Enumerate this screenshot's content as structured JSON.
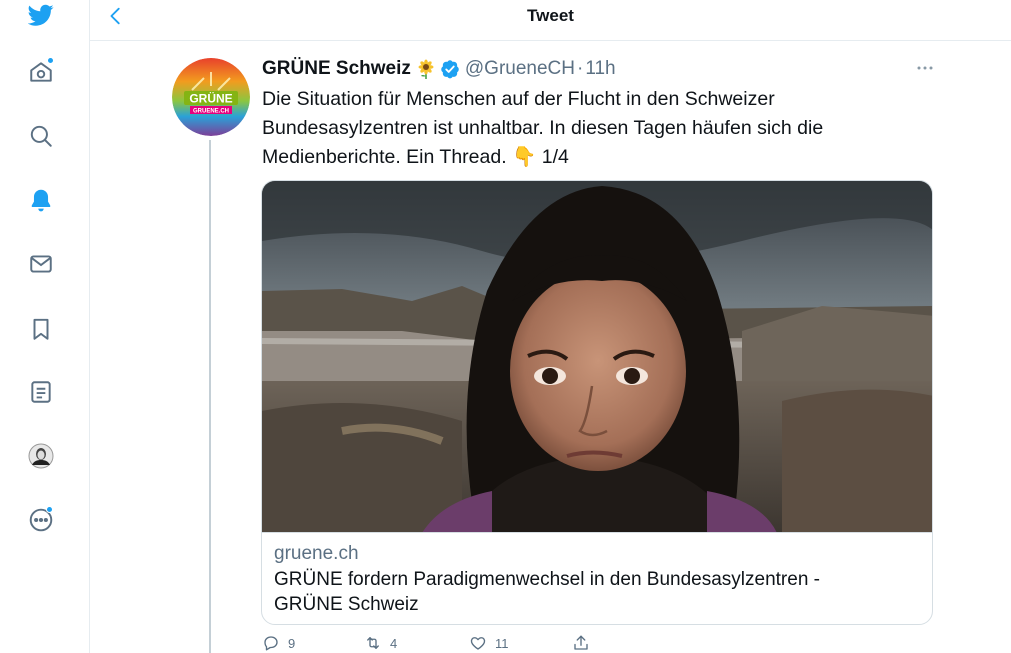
{
  "header": {
    "title": "Tweet"
  },
  "sidebar": {
    "items": [
      {
        "name": "twitter-logo-icon"
      },
      {
        "name": "home-icon"
      },
      {
        "name": "explore-icon"
      },
      {
        "name": "notifications-icon"
      },
      {
        "name": "messages-icon"
      },
      {
        "name": "bookmarks-icon"
      },
      {
        "name": "lists-icon"
      },
      {
        "name": "profile-avatar"
      },
      {
        "name": "more-icon"
      }
    ],
    "accent": "#1da1f2"
  },
  "tweet": {
    "display_name": "GRÜNE Schweiz",
    "name_emoji": "🌻",
    "handle": "@GrueneCH",
    "separator": "·",
    "time": "11h",
    "avatar_text_top": "GRÜNE",
    "avatar_text_bottom": "GRUENE.CH",
    "text_lines": [
      "Die Situation für Menschen auf der Flucht in den Schweizer",
      "Bundesasylzentren ist unhaltbar. In diesen Tagen häufen sich die",
      "Medienberichte. Ein Thread. 👇 1/4"
    ],
    "card": {
      "domain": "gruene.ch",
      "title_lines": [
        "GRÜNE fordern Paradigmenwechsel in den Bundesasylzentren -",
        "GRÜNE Schweiz"
      ]
    },
    "actions": {
      "reply_count": "9",
      "retweet_count": "4",
      "like_count": "11"
    }
  }
}
